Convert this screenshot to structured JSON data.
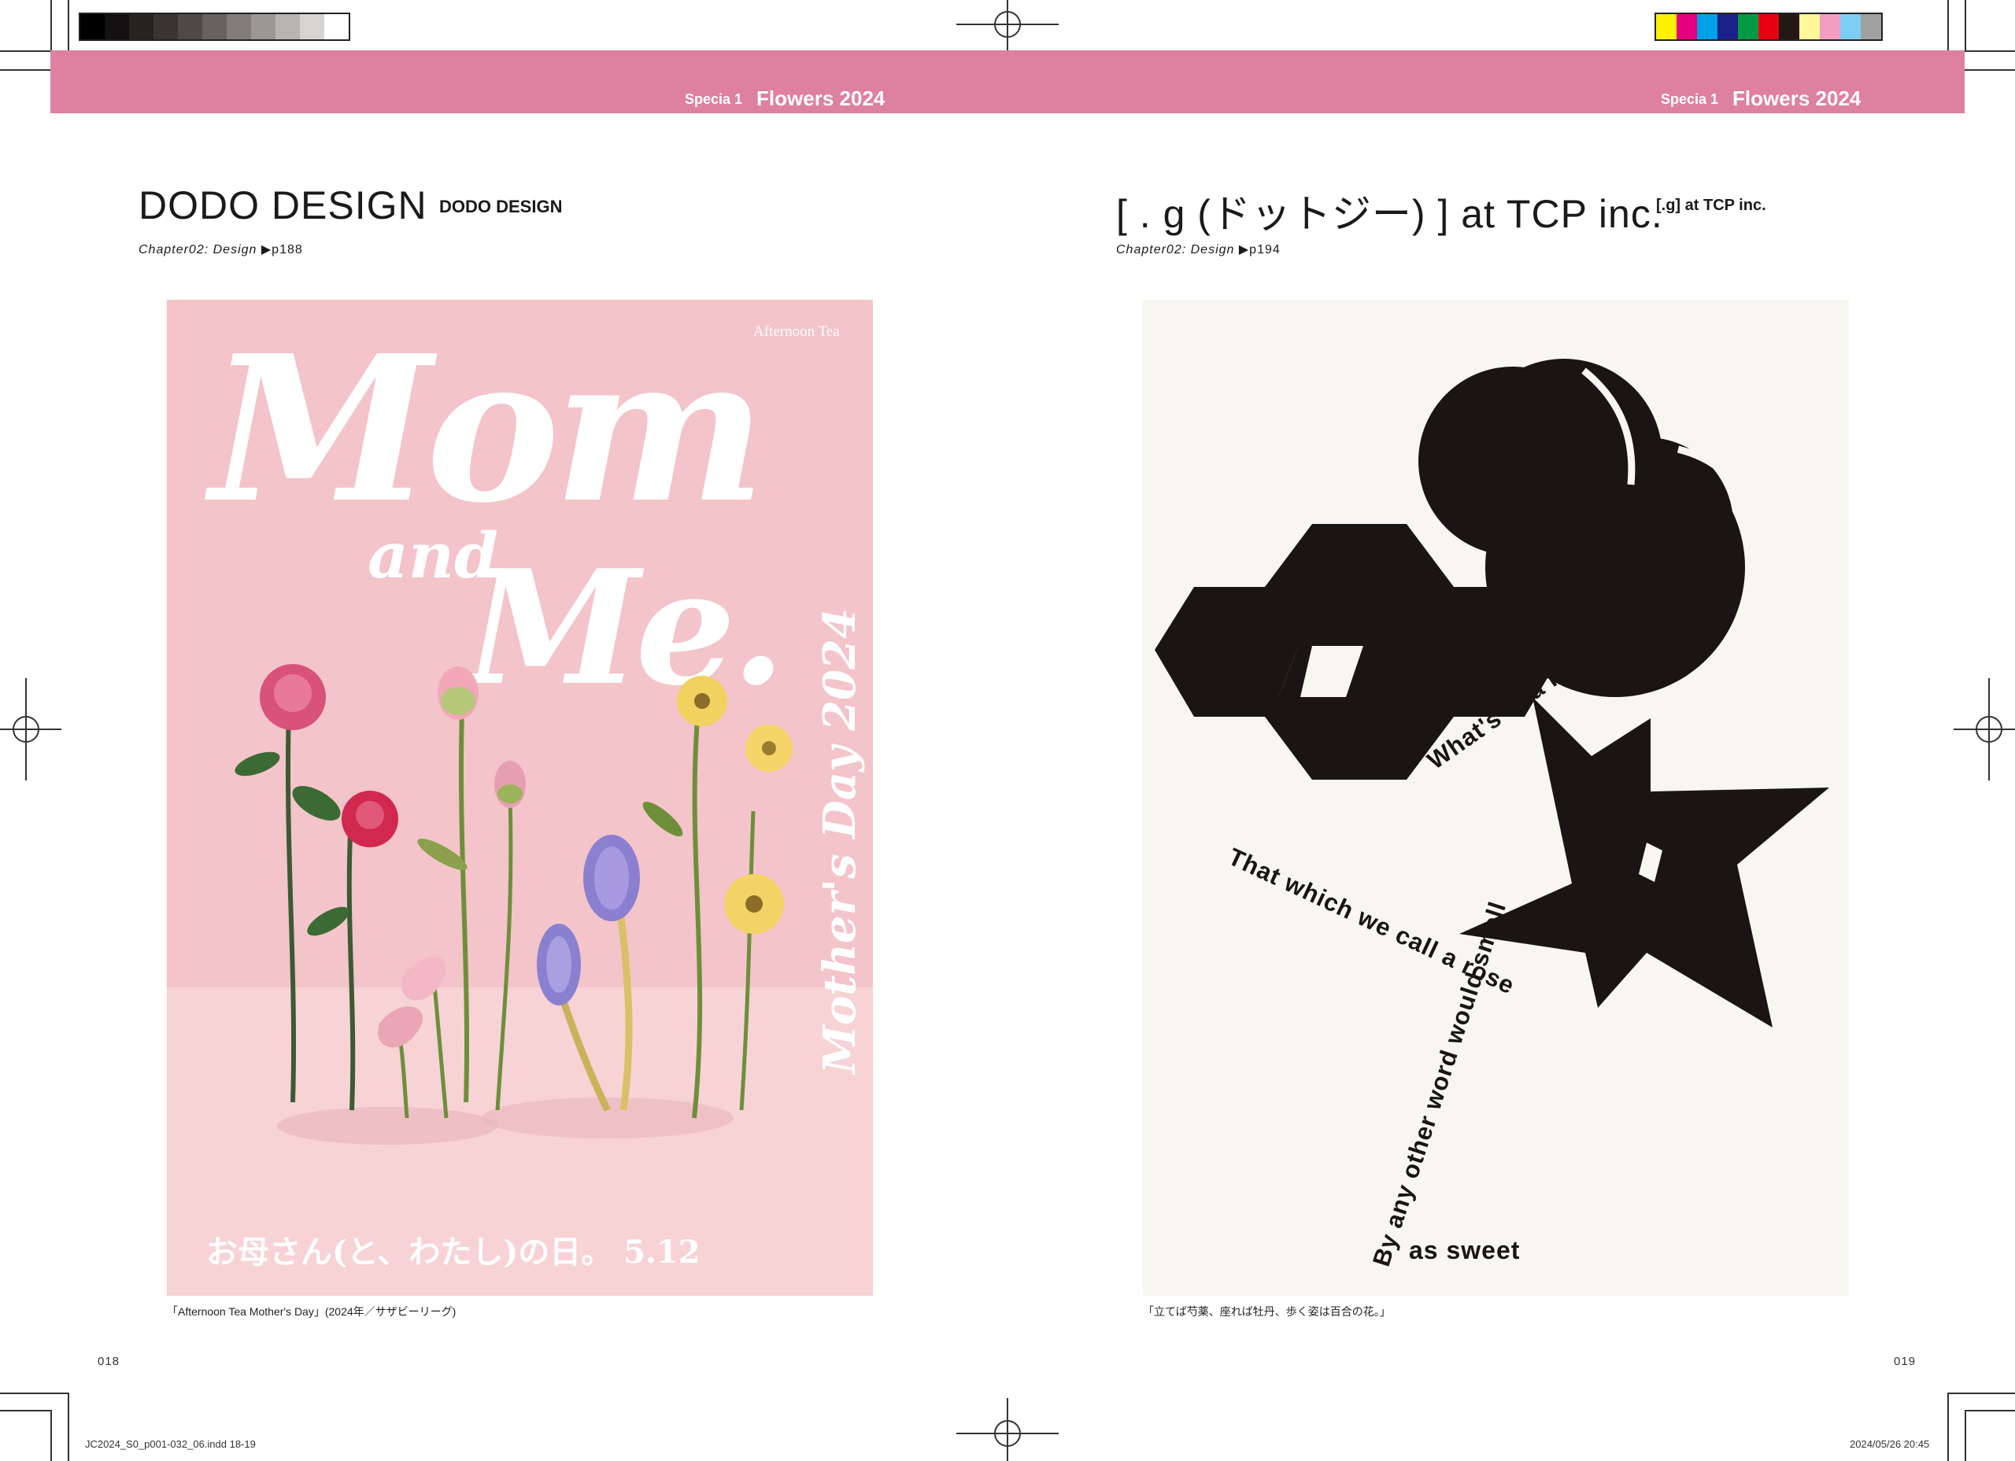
{
  "colors": {
    "header_pink": "#de809f",
    "poster_pink": "#f3c4ca",
    "poster_cream": "#f7f6f1",
    "grey_swatches": [
      "#000000",
      "#121010",
      "#272322",
      "#3a3534",
      "#4f4949",
      "#676161",
      "#827c7c",
      "#9c9797",
      "#b8b4b3",
      "#d6d4d2",
      "#ffffff"
    ],
    "color_swatches": [
      "#fff200",
      "#e4007f",
      "#00a0e9",
      "#1d2088",
      "#009944",
      "#e60012",
      "#231815",
      "#fff799",
      "#f19ec2",
      "#7ecef4",
      "#9fa0a0"
    ]
  },
  "header": {
    "left": {
      "small": "Specia 1",
      "big": "Flowers 2024"
    },
    "right": {
      "small": "Specia 1",
      "big": "Flowers 2024"
    }
  },
  "left_page": {
    "title": "DODO DESIGN",
    "subtitle": "DODO DESIGN",
    "chapter": "Chapter02: Design",
    "page_ref": "▶︎p188",
    "caption": "「Afternoon Tea Mother's Day」(2024年／サザビーリーグ)",
    "folio": "018",
    "poster": {
      "brand": "Afternoon Tea",
      "headline_1": "Mom",
      "headline_2": "and",
      "headline_3": "Me.",
      "vertical": "Mother's Day 2024",
      "bottom": "お母さん(と、わたし)の日。 5.12"
    }
  },
  "right_page": {
    "title": "[ . g (ドットジー) ] at TCP inc.",
    "subtitle": "[.g] at TCP inc.",
    "chapter": "Chapter02: Design",
    "page_ref": "▶︎p194",
    "caption": "「立てば芍薬、座れば牡丹、歩く姿は百合の花。」",
    "folio": "019",
    "poster": {
      "line1": "What's in a name?",
      "line2": "That which we call a rose",
      "line3": "By any other word would smell",
      "line4": "as sweet"
    }
  },
  "slug": {
    "file": "JC2024_S0_p001-032_06.indd   18-19",
    "datetime": "2024/05/26   20:45"
  }
}
